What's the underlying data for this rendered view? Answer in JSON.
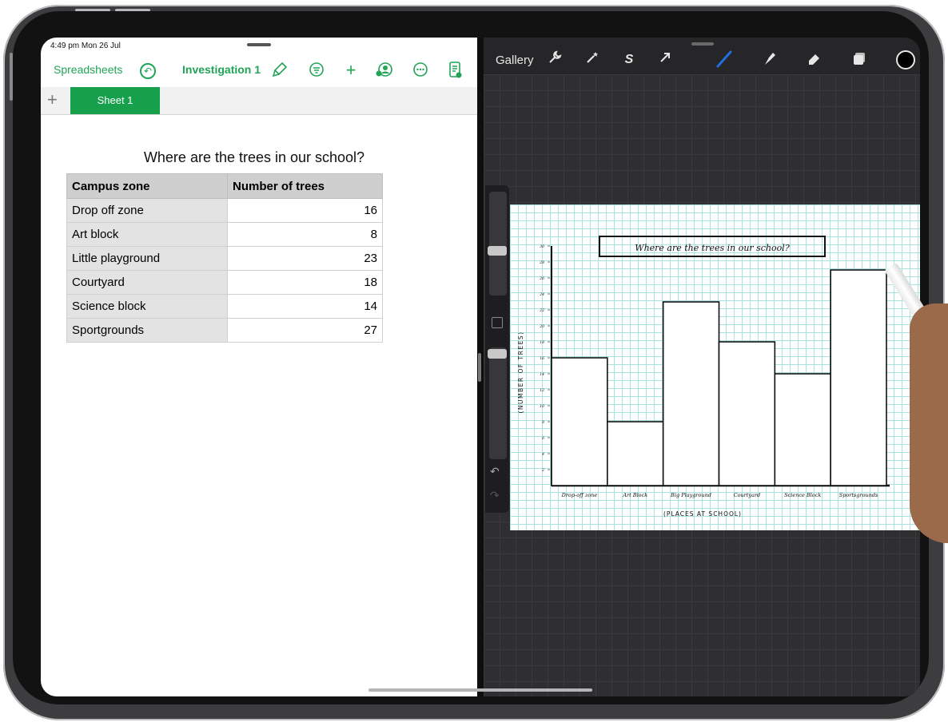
{
  "status": {
    "time_date": "4:49 pm  Mon 26 Jul"
  },
  "numbers_app": {
    "back_label": "Spreadsheets",
    "doc_title": "Investigation 1",
    "tabs": [
      {
        "label": "Sheet 1"
      }
    ],
    "table_title": "Where are the trees in our school?",
    "headers": [
      "Campus zone",
      "Number of trees"
    ],
    "rows": [
      {
        "zone": "Drop off zone",
        "trees": "16"
      },
      {
        "zone": "Art block",
        "trees": "8"
      },
      {
        "zone": "Little playground",
        "trees": "23"
      },
      {
        "zone": "Courtyard",
        "trees": "18"
      },
      {
        "zone": "Science block",
        "trees": "14"
      },
      {
        "zone": "Sportgrounds",
        "trees": "27"
      }
    ],
    "accent_color": "#21a456",
    "tab_color": "#16a04c"
  },
  "procreate_app": {
    "gallery_label": "Gallery",
    "icons": [
      "wrench-icon",
      "magic-wand-icon",
      "selection-icon",
      "transform-arrow-icon",
      "brush-icon",
      "smudge-icon",
      "eraser-icon",
      "layers-icon",
      "color-picker-icon"
    ],
    "brush_color": "#1f6fe0"
  },
  "chart_data": {
    "type": "bar",
    "title": "Where are the trees in our school?",
    "xlabel": "(PLACES AT SCHOOL)",
    "ylabel": "(NUMBER OF TREES)",
    "categories": [
      "Drop-off zone",
      "Art Block",
      "Big Playground",
      "Courtyard",
      "Science Block",
      "Sportsgrounds"
    ],
    "values": [
      16,
      8,
      23,
      18,
      14,
      27
    ],
    "ylim": [
      0,
      30
    ],
    "yticks": [
      "2",
      "4",
      "6",
      "8",
      "10",
      "12",
      "14",
      "16",
      "18",
      "20",
      "22",
      "24",
      "26",
      "28",
      "30"
    ],
    "grid": true
  }
}
